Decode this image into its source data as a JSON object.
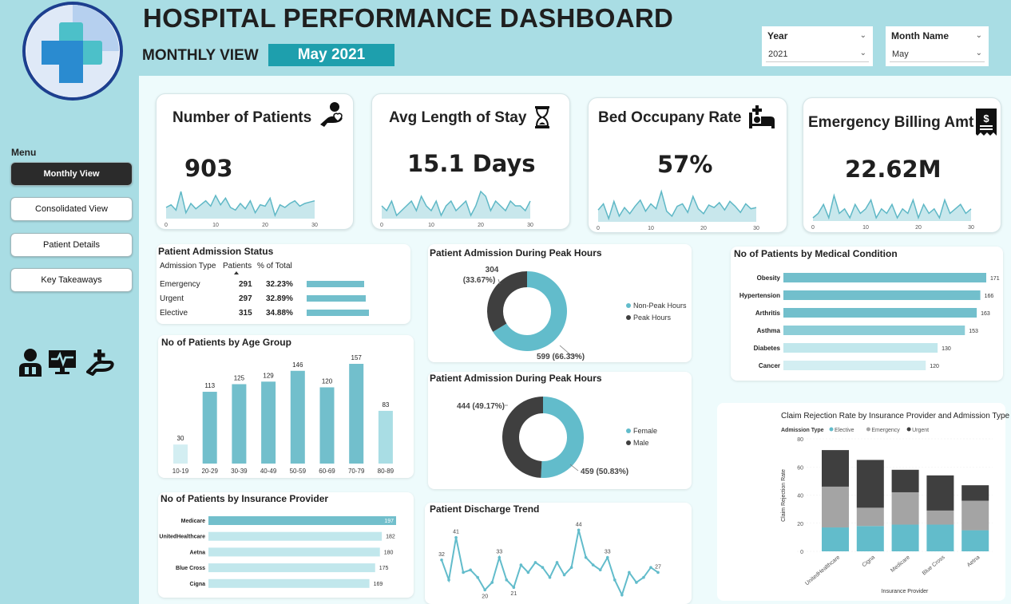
{
  "header": {
    "title": "HOSPITAL PERFORMANCE DASHBOARD",
    "subtitle": "MONTHLY VIEW",
    "current_month": "May 2021"
  },
  "filters": {
    "year": {
      "label": "Year",
      "value": "2021"
    },
    "month": {
      "label": "Month Name",
      "value": "May"
    }
  },
  "menu": {
    "label": "Menu",
    "items": [
      {
        "label": "Monthly View",
        "active": true
      },
      {
        "label": "Consolidated View",
        "active": false
      },
      {
        "label": "Patient Details",
        "active": false
      },
      {
        "label": "Key Takeaways",
        "active": false
      }
    ]
  },
  "icons": [
    "doctor-icon",
    "monitor-heartbeat-icon",
    "hand-care-icon",
    "plus-cross-icon",
    "hospital-bed-icon",
    "hourglass-icon",
    "receipt-icon",
    "patient-care-icon"
  ],
  "colors": {
    "accent": "#1e9fad",
    "teal": "#72bfcc",
    "light_teal": "#a9dde4",
    "dark": "#3f3f3f",
    "gray": "#a4a4a4"
  },
  "kpis": [
    {
      "title": "Number of Patients",
      "value": "903",
      "icon": "patient-care-icon",
      "ticks": [
        "0",
        "10",
        "20",
        "30"
      ]
    },
    {
      "title": "Avg Length of Stay",
      "value": "15.1 Days",
      "icon": "hourglass-icon",
      "ticks": [
        "0",
        "10",
        "20",
        "30"
      ]
    },
    {
      "title": "Bed Occupany Rate",
      "value": "57%",
      "icon": "hospital-bed-icon",
      "ticks": [
        "0",
        "10",
        "20",
        "30"
      ]
    },
    {
      "title": "Emergency Billing Amt",
      "value": "22.62M",
      "icon": "receipt-icon",
      "ticks": [
        "0",
        "10",
        "20",
        "30"
      ]
    }
  ],
  "admission_status": {
    "title": "Patient Admission Status",
    "columns": [
      "Admission Type",
      "Patients",
      "% of Total"
    ],
    "rows": [
      {
        "type": "Emergency",
        "patients": "291",
        "pct": "32.23%"
      },
      {
        "type": "Urgent",
        "patients": "297",
        "pct": "32.89%"
      },
      {
        "type": "Elective",
        "patients": "315",
        "pct": "34.88%"
      }
    ]
  },
  "chart_data": [
    {
      "type": "line",
      "title": "Number of Patients",
      "x_range": [
        0,
        30
      ],
      "values": [
        28,
        30,
        26,
        40,
        24,
        31,
        27,
        30,
        33,
        29,
        37,
        30,
        35,
        28,
        26,
        31,
        27,
        33,
        24,
        30,
        29,
        35,
        22,
        30,
        28,
        31,
        33,
        29,
        31,
        32,
        33
      ]
    },
    {
      "type": "line",
      "title": "Avg Length of Stay",
      "x_range": [
        0,
        30
      ],
      "values": [
        15,
        14,
        16,
        13,
        14,
        15,
        16,
        14,
        17,
        15,
        14,
        16,
        13,
        15,
        16,
        14,
        15,
        16,
        13,
        15,
        18,
        17,
        14,
        16,
        15,
        14,
        16,
        15,
        15,
        14,
        16
      ]
    },
    {
      "type": "line",
      "title": "Bed Occupany Rate",
      "x_range": [
        0,
        30
      ],
      "values": [
        55,
        60,
        48,
        62,
        50,
        57,
        52,
        58,
        63,
        54,
        60,
        56,
        70,
        54,
        50,
        58,
        60,
        53,
        66,
        56,
        52,
        59,
        57,
        61,
        55,
        62,
        58,
        53,
        60,
        56,
        57
      ]
    },
    {
      "type": "line",
      "title": "Emergency Billing Amt",
      "x_range": [
        0,
        30
      ],
      "values": [
        0.6,
        0.7,
        0.9,
        0.6,
        1.1,
        0.7,
        0.8,
        0.6,
        0.9,
        0.7,
        0.8,
        1.0,
        0.6,
        0.8,
        0.7,
        0.9,
        0.6,
        0.8,
        0.7,
        1.0,
        0.6,
        0.9,
        0.7,
        0.8,
        0.6,
        1.0,
        0.7,
        0.8,
        0.9,
        0.7,
        0.8
      ]
    },
    {
      "type": "pie",
      "title": "Patient Admission During Peak Hours",
      "slices": [
        {
          "name": "Non-Peak Hours",
          "value": 599,
          "label": "599 (66.33%)",
          "color": "#62bccb"
        },
        {
          "name": "Peak Hours",
          "value": 304,
          "label": "304 (33.67%)",
          "color": "#3f3f3f"
        }
      ],
      "legend": "right"
    },
    {
      "type": "pie",
      "title": "Patient Admission During Peak Hours",
      "slices": [
        {
          "name": "Female",
          "value": 459,
          "label": "459 (50.83%)",
          "color": "#62bccb"
        },
        {
          "name": "Male",
          "value": 444,
          "label": "444 (49.17%)",
          "color": "#3f3f3f"
        }
      ],
      "legend": "right"
    },
    {
      "type": "bar",
      "title": "No of Patients by Age Group",
      "categories": [
        "10-19",
        "20-29",
        "30-39",
        "40-49",
        "50-59",
        "60-69",
        "70-79",
        "80-89"
      ],
      "values": [
        30,
        113,
        125,
        129,
        146,
        120,
        157,
        83
      ]
    },
    {
      "type": "bar",
      "orientation": "horizontal",
      "title": "No of Patients by Medical Condition",
      "categories": [
        "Obesity",
        "Hypertension",
        "Arthritis",
        "Asthma",
        "Diabetes",
        "Cancer"
      ],
      "values": [
        171,
        166,
        163,
        153,
        130,
        120
      ]
    },
    {
      "type": "bar",
      "orientation": "horizontal",
      "title": "No of Patients by Insurance Provider",
      "categories": [
        "Medicare",
        "UnitedHealthcare",
        "Aetna",
        "Blue Cross",
        "Cigna"
      ],
      "values": [
        197,
        182,
        180,
        175,
        169
      ]
    },
    {
      "type": "line",
      "title": "Patient Discharge Trend",
      "labels_shown": [
        "32",
        "41",
        "20",
        "33",
        "21",
        "44",
        "33",
        "27"
      ],
      "values": [
        32,
        24,
        41,
        27,
        28,
        25,
        20,
        23,
        33,
        24,
        21,
        30,
        27,
        31,
        29,
        25,
        31,
        26,
        29,
        44,
        33,
        30,
        28,
        33,
        24,
        18,
        27,
        23,
        25,
        29,
        27
      ]
    },
    {
      "type": "bar",
      "stacked": true,
      "title": "Claim Rejection Rate by Insurance Provider and Admission Type",
      "legend_title": "Admission Type",
      "legend": "top-left",
      "xlabel": "Insurance Provider",
      "ylabel": "Claim Rejection Rate",
      "ylim": [
        0,
        80
      ],
      "yticks": [
        "0",
        "20",
        "40",
        "60",
        "80"
      ],
      "categories": [
        "UnitedHealthcare",
        "Cigna",
        "Medicare",
        "Blue Cross",
        "Aetna"
      ],
      "series": [
        {
          "name": "Elective",
          "values": [
            17,
            18,
            19,
            19,
            15
          ],
          "color": "#62bccb"
        },
        {
          "name": "Emergency",
          "values": [
            29,
            13,
            23,
            10,
            21
          ],
          "color": "#a4a4a4"
        },
        {
          "name": "Urgent",
          "values": [
            26,
            34,
            16,
            25,
            11
          ],
          "color": "#3f3f3f"
        }
      ]
    }
  ]
}
